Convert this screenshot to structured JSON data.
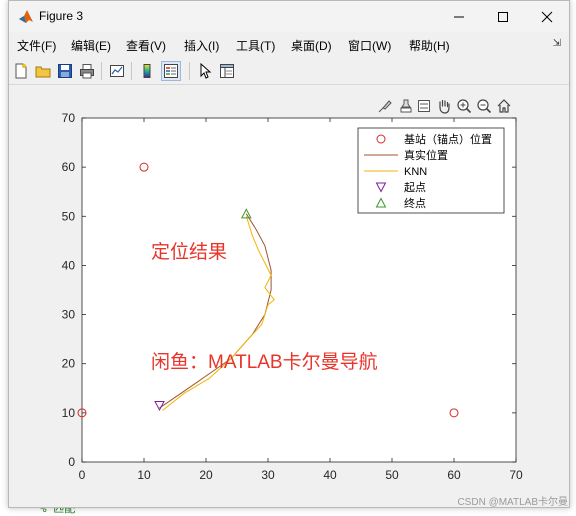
{
  "window": {
    "title": "Figure 3"
  },
  "menu": [
    "文件(F)",
    "编辑(E)",
    "查看(V)",
    "插入(I)",
    "工具(T)",
    "桌面(D)",
    "窗口(W)",
    "帮助(H)"
  ],
  "background": {
    "bottom_code": "% 匹配"
  },
  "annotations": {
    "main": "定位结果",
    "sub": "闲鱼：MATLAB卡尔曼导航"
  },
  "watermark": "CSDN @MATLAB卡尔曼",
  "colors": {
    "anchor": "#d62728",
    "true_path": "#a0522d",
    "knn": "#f0b400",
    "start": "#7a1fa2",
    "end": "#3c9a2b",
    "annotation": "#e8352b"
  },
  "chart_data": {
    "type": "line",
    "xlim": [
      0,
      70
    ],
    "ylim": [
      0,
      70
    ],
    "xticks": [
      0,
      10,
      20,
      30,
      40,
      50,
      60,
      70
    ],
    "yticks": [
      0,
      10,
      20,
      30,
      40,
      50,
      60,
      70
    ],
    "legend_position": "top-right",
    "legend": [
      "基站（锚点）位置",
      "真实位置",
      "KNN",
      "起点",
      "终点"
    ],
    "anchors": [
      [
        0,
        10
      ],
      [
        10,
        60
      ],
      [
        60,
        10
      ]
    ],
    "series": [
      {
        "name": "真实位置",
        "x": [
          12.5,
          16,
          20,
          24,
          27.5,
          29.5,
          30.5,
          30.5,
          29.5,
          28,
          26.5
        ],
        "y": [
          11,
          14,
          17.5,
          21,
          26,
          30,
          35,
          39,
          44,
          47.5,
          50.5
        ]
      },
      {
        "name": "KNN",
        "x": [
          13,
          16.5,
          20.5,
          24,
          26.8,
          29,
          30,
          31,
          29.5,
          30.5,
          28.5,
          27.5,
          26.5
        ],
        "y": [
          10.5,
          14,
          17,
          21,
          25,
          28,
          32,
          33,
          35.5,
          38,
          43,
          46,
          50
        ]
      }
    ],
    "start": [
      12.5,
      11.5
    ],
    "end": [
      26.5,
      50.5
    ]
  }
}
